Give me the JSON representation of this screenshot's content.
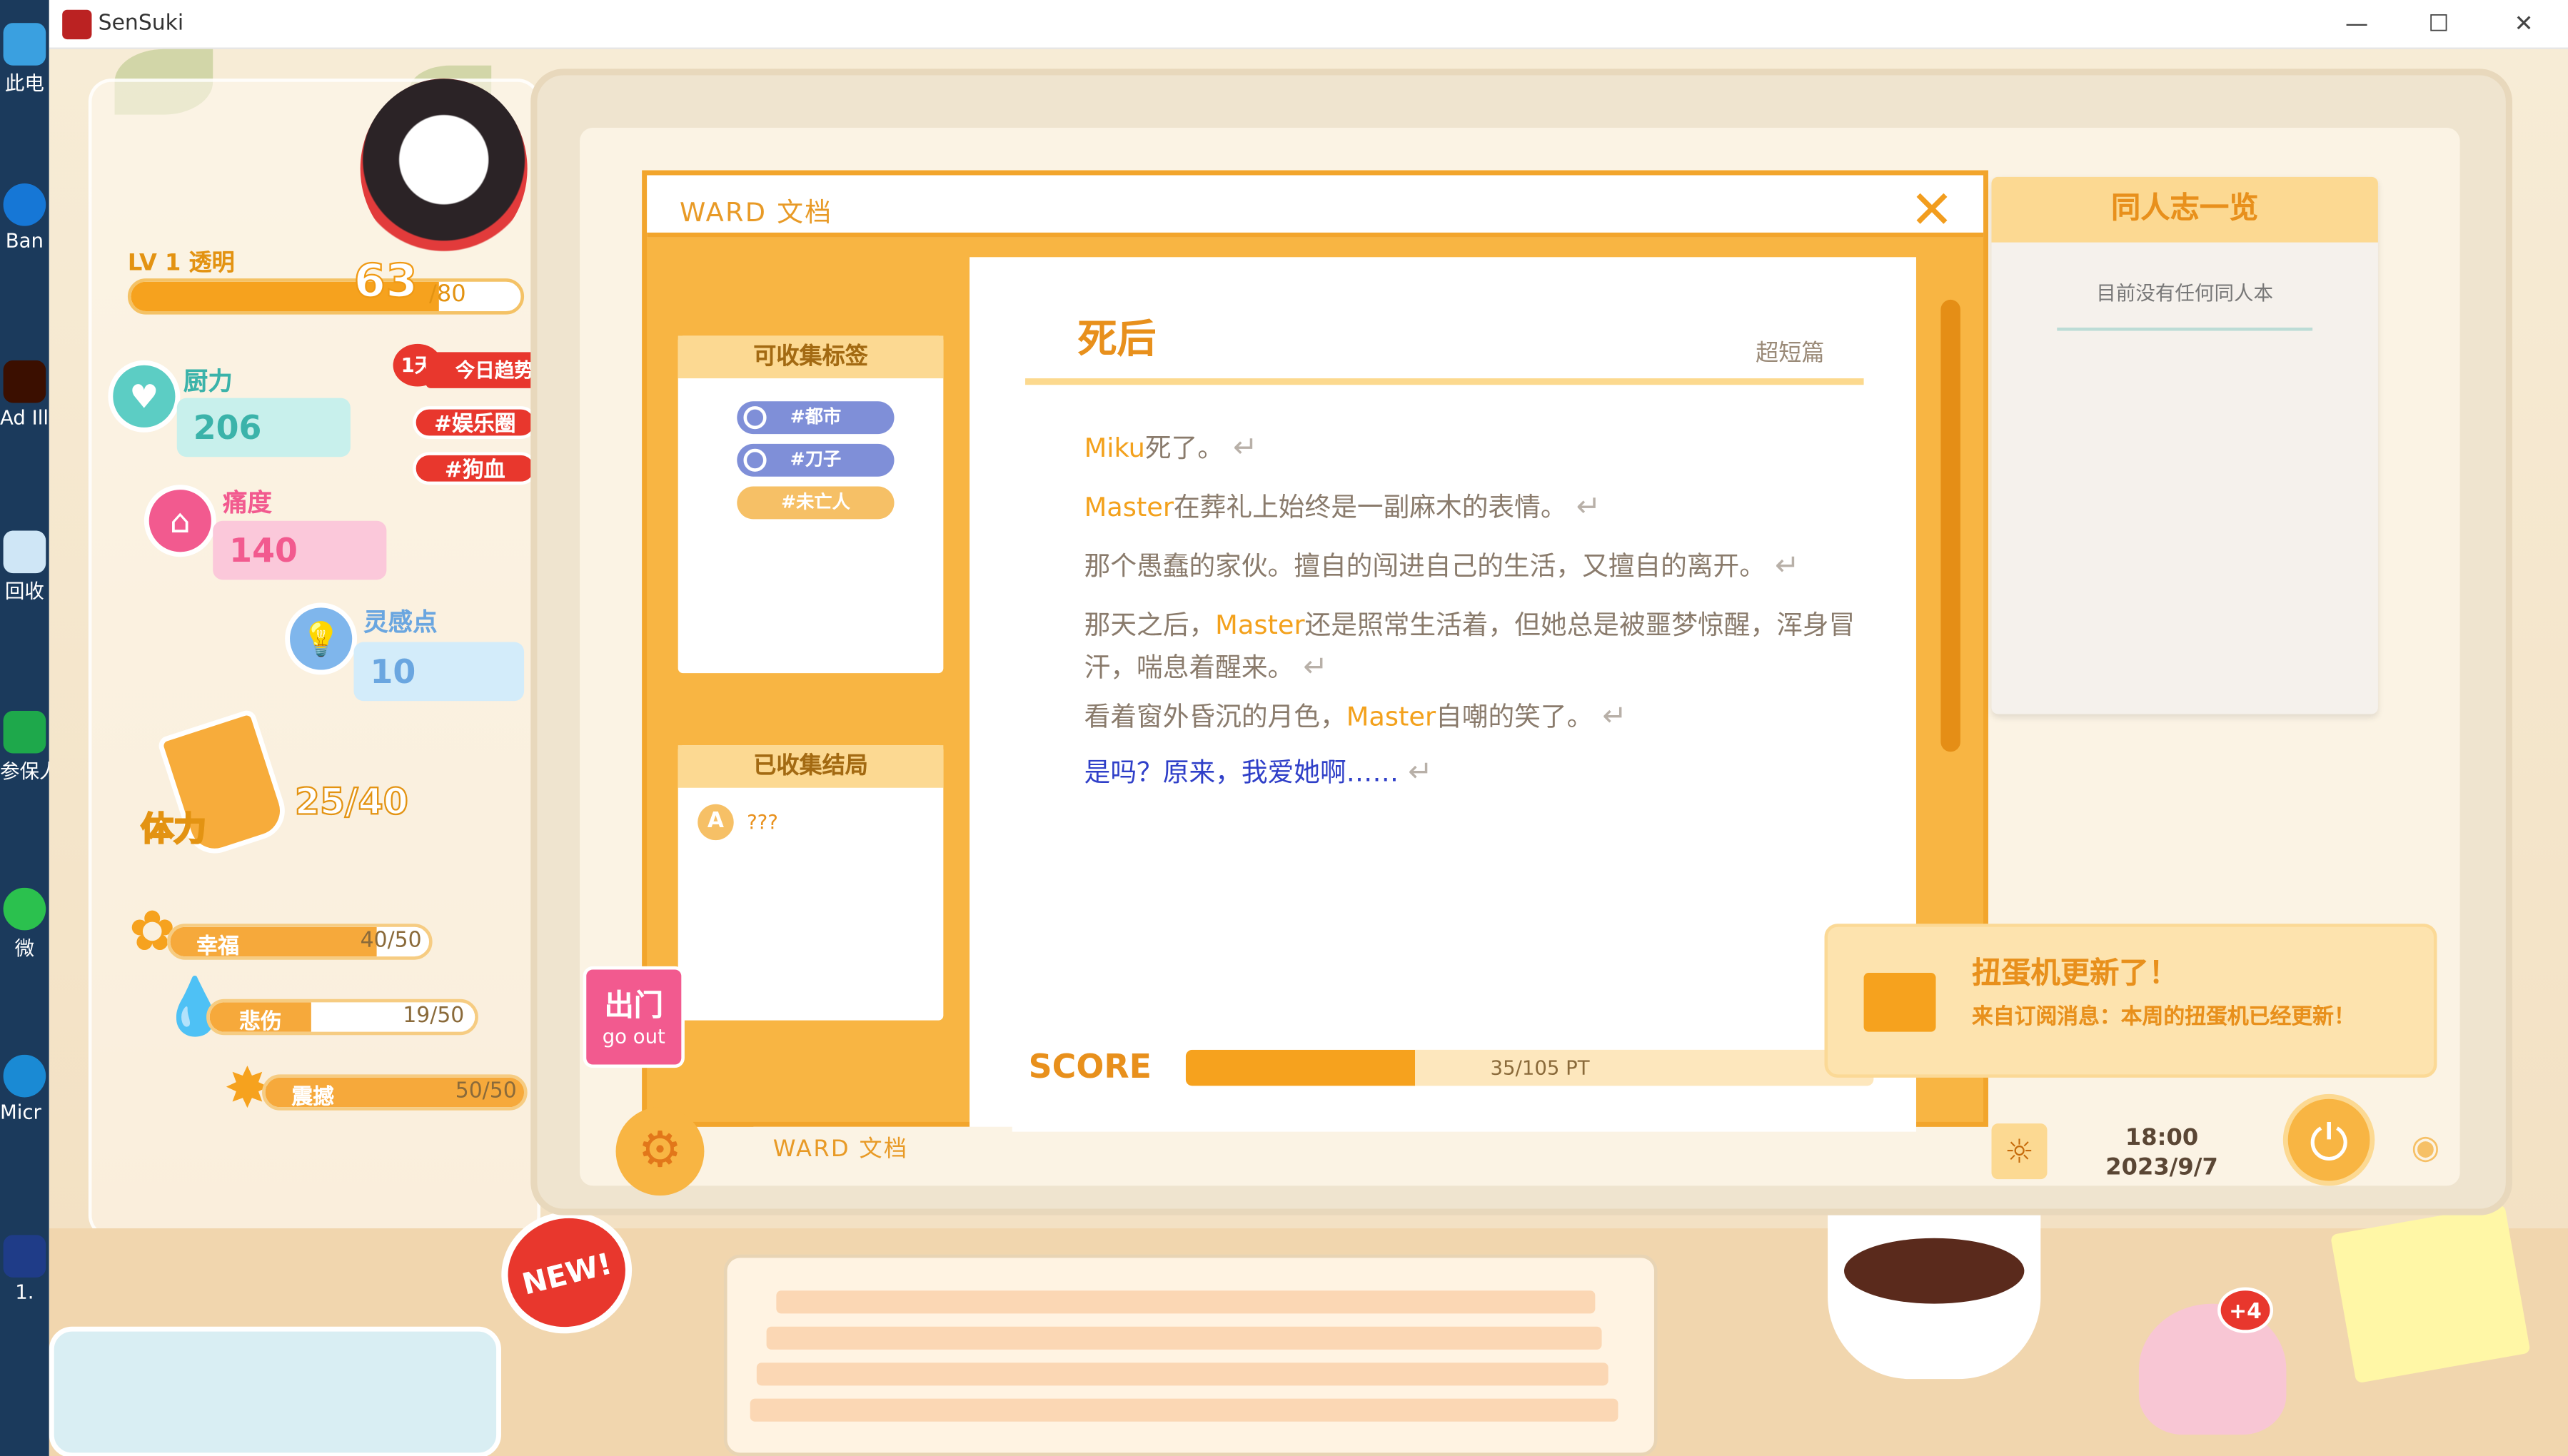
{
  "window": {
    "title": "SenSuki",
    "controls": [
      "—",
      "☐",
      "✕"
    ]
  },
  "desktop": {
    "icons": [
      "此电",
      "Ban",
      "Ad Illustr",
      "回收",
      "参保人 失败",
      "微",
      "Micr Ed",
      "1."
    ]
  },
  "player": {
    "level_label": "LV 1 透明",
    "level_current": "63",
    "level_max": "/80",
    "level_fraction": 0.79
  },
  "stats": {
    "cooking": {
      "label": "厨力",
      "value": "206"
    },
    "pain": {
      "label": "痛度",
      "value": "140"
    },
    "inspiration": {
      "label": "灵感点",
      "value": "10"
    }
  },
  "trend": {
    "days": "1天",
    "title": "今日趋势",
    "tags": [
      "#娱乐圈",
      "#狗血"
    ]
  },
  "stamina": {
    "label": "体力",
    "value": "25/40"
  },
  "emotions": [
    {
      "label": "幸福",
      "value": "40/50",
      "fraction": 0.8
    },
    {
      "label": "悲伤",
      "value": "19/50",
      "fraction": 0.38
    },
    {
      "label": "震撼",
      "value": "50/50",
      "fraction": 1.0
    }
  ],
  "ward": {
    "title": "WARD 文档",
    "close_label": "✕",
    "tags_head": "可收集标签",
    "tags": [
      "#都市",
      "#刀子",
      "#未亡人"
    ],
    "tags_colors": [
      "#7f8fd8",
      "#7f8fd8",
      "#f6c066"
    ],
    "endings_head": "已收集结局",
    "endings": [
      {
        "badge": "A",
        "text": "???"
      }
    ],
    "doc": {
      "title": "死后",
      "kind": "超短篇",
      "lines": [
        {
          "parts": [
            {
              "t": "Miku",
              "hl": true
            },
            {
              "t": "死了。"
            }
          ]
        },
        {
          "parts": [
            {
              "t": "Master",
              "hl": true
            },
            {
              "t": "在葬礼上始终是一副麻木的表情。"
            }
          ]
        },
        {
          "parts": [
            {
              "t": "那个愚蠢的家伙。擅自的闯进自己的生活，又擅自的离开。"
            }
          ]
        },
        {
          "parts": [
            {
              "t": "那天之后，"
            },
            {
              "t": "Master",
              "hl": true
            },
            {
              "t": "还是照常生活着，但她总是被噩梦惊醒，浑身冒汗，喘息着醒来。"
            }
          ]
        },
        {
          "parts": [
            {
              "t": "看着窗外昏沉的月色，"
            },
            {
              "t": "Master",
              "hl": true
            },
            {
              "t": "自嘲的笑了。"
            }
          ]
        },
        {
          "parts": [
            {
              "t": "是吗？原来，我爱她啊……"
            }
          ],
          "last": true
        }
      ],
      "enter_mark": "↵"
    },
    "score_label": "SCORE",
    "score_text": "35/105 PT",
    "score_fraction": 0.333
  },
  "doujin": {
    "title": "同人志一览",
    "empty": "目前没有任何同人本"
  },
  "notice": {
    "title": "扭蛋机更新了！",
    "body": "来自订阅消息：本周的扭蛋机已经更新！"
  },
  "goout": {
    "cn": "出门",
    "en": "go out"
  },
  "taskbar": {
    "task_label": "WARD 文档",
    "time": "18:00",
    "date": "2023/9/7"
  },
  "badges": {
    "new": "NEW!",
    "plus": "+4"
  }
}
